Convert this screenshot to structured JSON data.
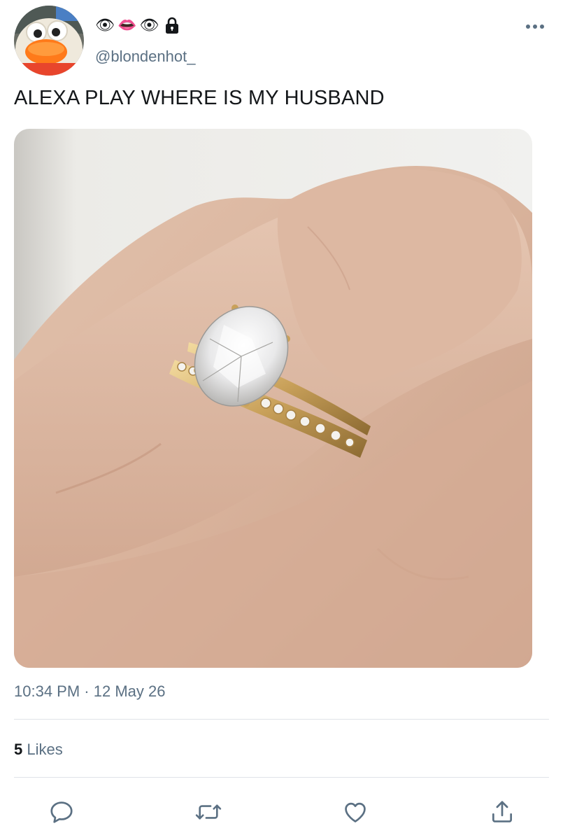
{
  "user": {
    "display_name_emojis": [
      "👁",
      "👄",
      "👁"
    ],
    "handle": "@blondenhot_",
    "protected": true
  },
  "tweet": {
    "text": "ALEXA PLAY WHERE IS MY HUSBAND",
    "time": "10:34 PM",
    "separator": "·",
    "date": "12 May 26",
    "likes_count": "5",
    "likes_label": "Likes"
  },
  "actions": [
    "reply-icon",
    "retweet-icon",
    "like-icon",
    "share-icon"
  ],
  "colors": {
    "text": "#14171a",
    "secondary": "#5b7083",
    "divider": "#dfe3e8",
    "icon": "#5b7083"
  }
}
